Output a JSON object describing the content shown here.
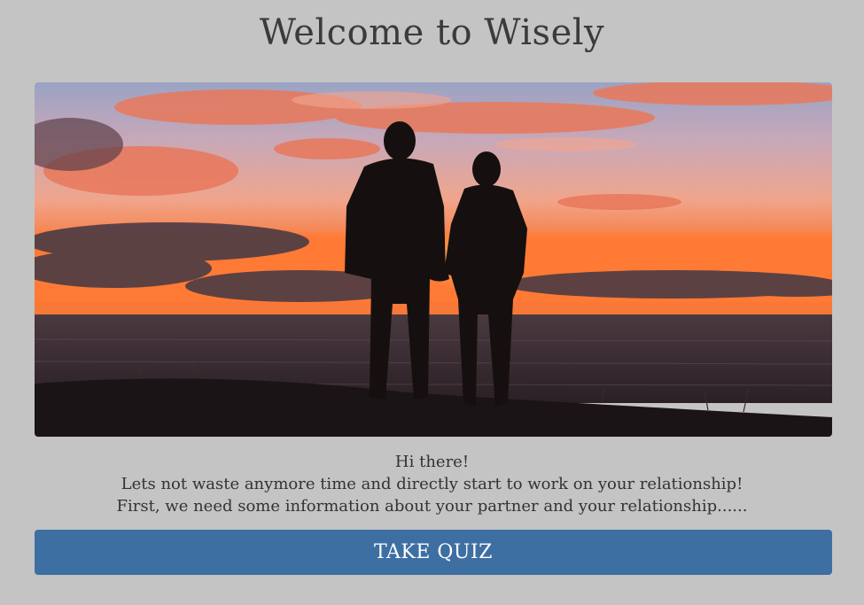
{
  "page": {
    "title": "Welcome to Wisely"
  },
  "hero": {
    "description_icon": "couple-sunset-photo"
  },
  "message": {
    "greeting": "Hi there!",
    "line1": "Lets not waste anymore time and directly start to work on your relationship!",
    "line2": "First, we need some information about your partner and your relationship......"
  },
  "actions": {
    "take_quiz_label": "TAKE QUIZ"
  },
  "colors": {
    "background": "#c4c4c4",
    "button": "#3e6fa3",
    "button_text": "#ffffff",
    "text": "#333333"
  }
}
